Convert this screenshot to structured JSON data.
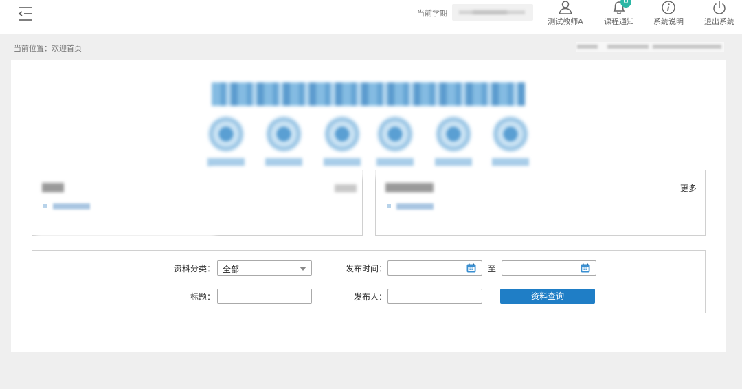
{
  "header": {
    "term_label": "当前学期",
    "nav": {
      "teacher": "测试教师A",
      "notice": "课程通知",
      "notice_badge": "0",
      "help": "系统说明",
      "logout": "退出系统"
    }
  },
  "breadcrumb": {
    "text": "当前位置：欢迎首页"
  },
  "news": {
    "right_more": "更多"
  },
  "search": {
    "category_label": "资料分类：",
    "category_value": "全部",
    "publish_time_label": "发布时间：",
    "to_label": "至",
    "title_label": "标题：",
    "publisher_label": "发布人：",
    "query_button": "资料查询"
  },
  "colors": {
    "accent": "#1f7ec6",
    "badge": "#2bb7a5",
    "page_bg": "#efefef"
  },
  "icons": {
    "menu": "menu-collapse-icon",
    "teacher": "user-icon",
    "notice": "bell-icon",
    "help": "info-icon",
    "logout": "power-icon",
    "calendar": "calendar-icon",
    "dropdown": "chevron-down-icon"
  }
}
